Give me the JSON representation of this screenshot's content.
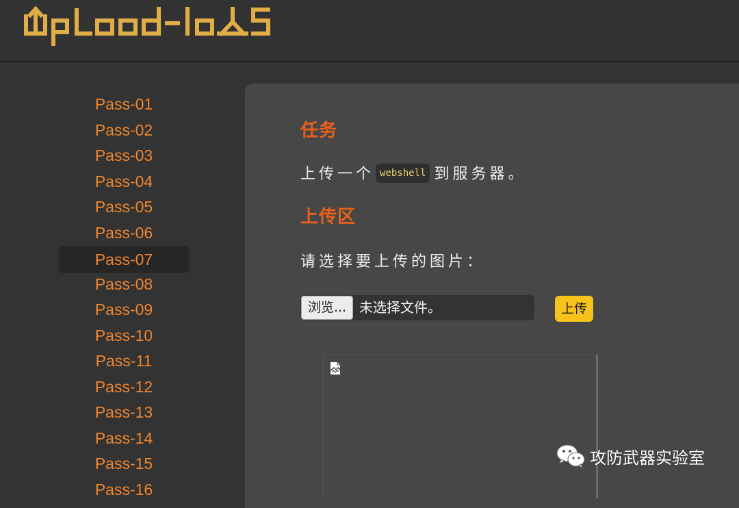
{
  "app": {
    "logo_text": "UpLoad-labS"
  },
  "sidebar": {
    "items": [
      {
        "label": "Pass-01"
      },
      {
        "label": "Pass-02"
      },
      {
        "label": "Pass-03"
      },
      {
        "label": "Pass-04"
      },
      {
        "label": "Pass-05"
      },
      {
        "label": "Pass-06"
      },
      {
        "label": "Pass-07",
        "active": true
      },
      {
        "label": "Pass-08"
      },
      {
        "label": "Pass-09"
      },
      {
        "label": "Pass-10"
      },
      {
        "label": "Pass-11"
      },
      {
        "label": "Pass-12"
      },
      {
        "label": "Pass-13"
      },
      {
        "label": "Pass-14"
      },
      {
        "label": "Pass-15"
      },
      {
        "label": "Pass-16"
      }
    ]
  },
  "task": {
    "title": "任务",
    "text_before": "上传一个",
    "code": "webshell",
    "text_after": "到服务器。"
  },
  "upload": {
    "title": "上传区",
    "prompt": "请选择要上传的图片：",
    "browse_label": "浏览...",
    "file_status": "未选择文件。",
    "submit_label": "上传"
  },
  "preview": {
    "icon": "broken-image-icon"
  },
  "watermark": {
    "icon": "wechat-icon",
    "text": "攻防武器实验室"
  },
  "colors": {
    "accent_orange": "#f0862e",
    "title_orange": "#e8611a",
    "logo_gold": "#e1ad47",
    "upload_yellow": "#f7c21a",
    "code_text": "#e8d56a"
  }
}
